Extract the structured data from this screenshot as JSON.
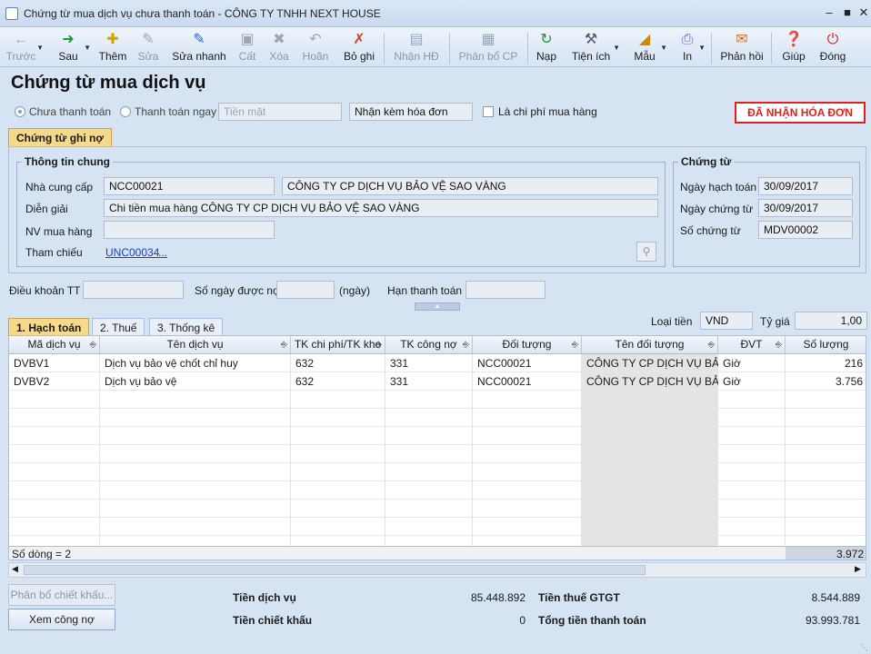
{
  "window": {
    "title": "Chứng từ mua dịch vụ chưa thanh toán - CÔNG TY TNHH NEXT HOUSE"
  },
  "toolbar": {
    "prev": "Trước",
    "next": "Sau",
    "add": "Thêm",
    "edit": "Sửa",
    "quick_edit": "Sửa nhanh",
    "save": "Cất",
    "delete": "Xóa",
    "undo": "Hoãn",
    "unpost": "Bỏ ghi",
    "receive_invoice": "Nhận HĐ",
    "allocate": "Phân bổ CP",
    "load": "Nạp",
    "utilities": "Tiện ích",
    "template": "Mẫu",
    "print": "In",
    "feedback": "Phản hồi",
    "help": "Giúp",
    "close": "Đóng"
  },
  "page": {
    "title": "Chứng từ mua dịch vụ",
    "radio_unpaid": "Chưa thanh toán",
    "radio_paid_now": "Thanh toán ngay",
    "payment_method_placeholder": "Tiền mặt",
    "invoice_mode": "Nhận kèm hóa đơn",
    "is_purchase_cost": "Là chi phí mua hàng",
    "status_badge": "ĐÃ NHẬN HÓA ĐƠN"
  },
  "tabs_top": {
    "voucher": "Chứng từ ghi nợ"
  },
  "general": {
    "title": "Thông tin chung",
    "supplier_label": "Nhà cung cấp",
    "supplier_code": "NCC00021",
    "supplier_name": "CÔNG TY CP DỊCH VỤ BẢO VỆ SAO VÀNG",
    "description_label": "Diễn giải",
    "description": "Chi tiền mua hàng CÔNG TY CP DỊCH VỤ BẢO VỆ SAO VÀNG",
    "buyer_label": "NV mua hàng",
    "buyer": "",
    "reference_label": "Tham chiếu",
    "reference": "UNC00034",
    "reference_more": "..."
  },
  "voucher": {
    "title": "Chứng từ",
    "posting_date_label": "Ngày hạch toán",
    "posting_date": "30/09/2017",
    "voucher_date_label": "Ngày chứng từ",
    "voucher_date": "30/09/2017",
    "voucher_no_label": "Số chứng từ",
    "voucher_no": "MDV00002"
  },
  "terms": {
    "payment_terms_label": "Điều khoản TT",
    "payment_terms": "",
    "credit_days_label": "Số ngày được nợ",
    "credit_days": "",
    "days_unit": "(ngày)",
    "due_date_label": "Hạn thanh toán",
    "due_date": ""
  },
  "currency": {
    "label": "Loại tiền",
    "value": "VND",
    "rate_label": "Tỷ giá",
    "rate": "1,00"
  },
  "tabs_bottom": {
    "accounting": "1. Hạch toán",
    "tax": "2. Thuế",
    "stats": "3. Thống kê"
  },
  "grid": {
    "headers": [
      "Mã dịch vụ",
      "Tên dịch vụ",
      "TK chi phí/TK kho",
      "TK công nợ",
      "Đối tượng",
      "Tên đối tượng",
      "ĐVT",
      "Số lượng"
    ],
    "rows": [
      [
        "DVBV1",
        "Dịch vụ bảo vệ chốt chỉ huy",
        "632",
        "331",
        "NCC00021",
        "CÔNG TY CP DỊCH VỤ BẢO",
        "Giờ",
        "216"
      ],
      [
        "DVBV2",
        "Dịch vụ bảo vệ",
        "632",
        "331",
        "NCC00021",
        "CÔNG TY CP DỊCH VỤ BẢO",
        "Giờ",
        "3.756"
      ]
    ],
    "row_count": "Số dòng = 2",
    "total_qty": "3.972"
  },
  "buttons": {
    "discount_alloc": "Phân bổ chiết khấu...",
    "view_debt": "Xem công nợ"
  },
  "summary": {
    "service_amount_label": "Tiền dịch vụ",
    "service_amount": "85.448.892",
    "discount_label": "Tiền chiết khấu",
    "discount": "0",
    "vat_label": "Tiền thuế GTGT",
    "vat": "8.544.889",
    "total_label": "Tổng tiền thanh toán",
    "total": "93.993.781"
  }
}
